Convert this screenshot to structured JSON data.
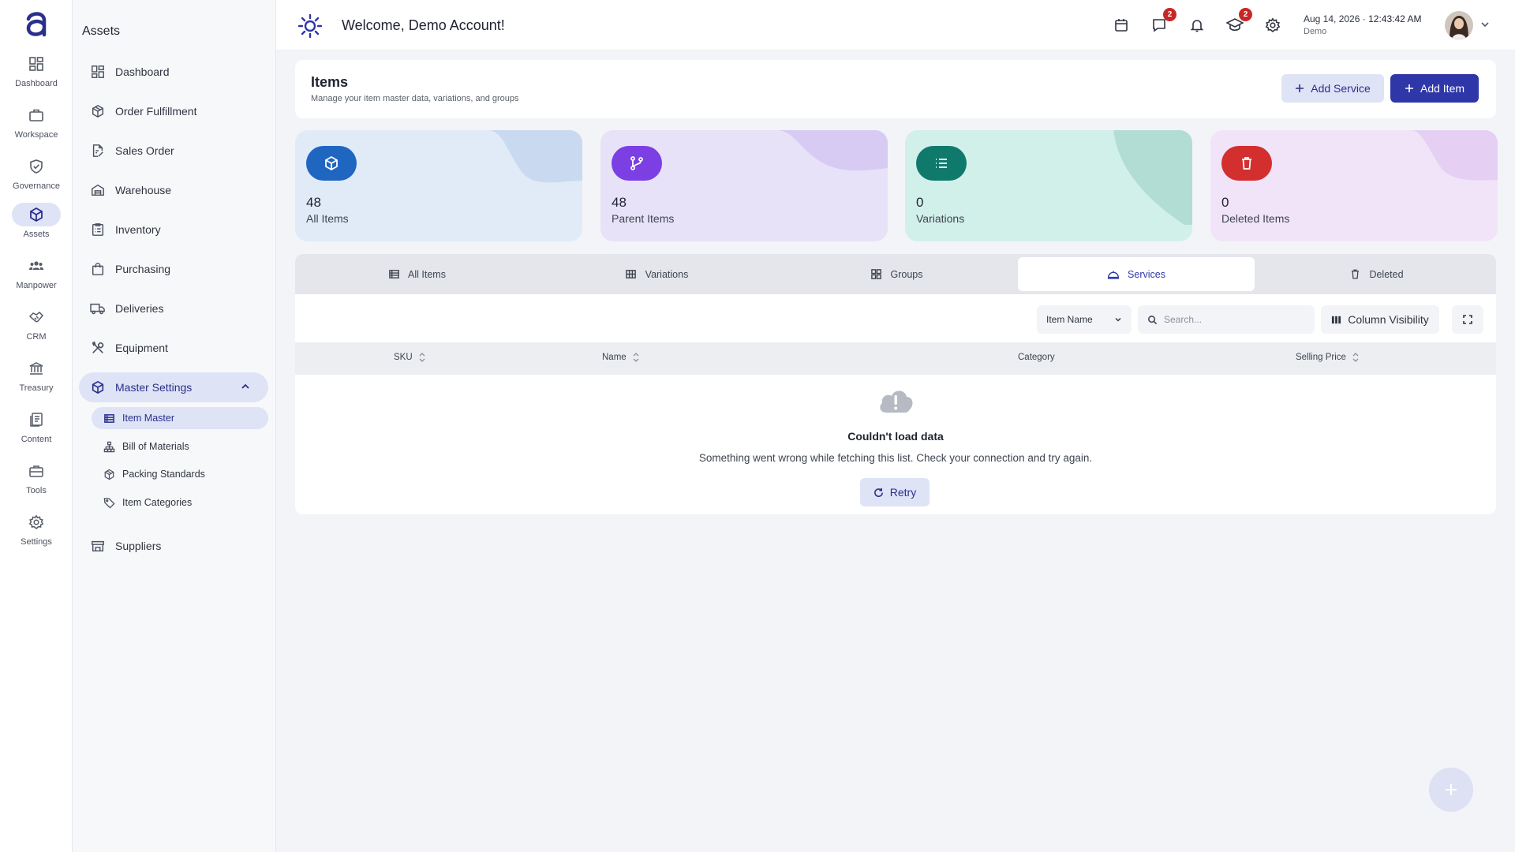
{
  "rail": {
    "items": [
      {
        "label": "Dashboard",
        "icon": "dashboard-grid-icon"
      },
      {
        "label": "Workspace",
        "icon": "briefcase-icon"
      },
      {
        "label": "Governance",
        "icon": "shield-check-icon"
      },
      {
        "label": "Assets",
        "icon": "cube-icon"
      },
      {
        "label": "Manpower",
        "icon": "people-icon"
      },
      {
        "label": "CRM",
        "icon": "handshake-icon"
      },
      {
        "label": "Treasury",
        "icon": "bank-icon"
      },
      {
        "label": "Content",
        "icon": "documents-icon"
      },
      {
        "label": "Tools",
        "icon": "toolbox-icon"
      },
      {
        "label": "Settings",
        "icon": "gear-icon"
      }
    ],
    "active": "Assets"
  },
  "sidebar": {
    "title": "Assets",
    "items": [
      {
        "label": "Dashboard"
      },
      {
        "label": "Order Fulfillment"
      },
      {
        "label": "Sales Order"
      },
      {
        "label": "Warehouse"
      },
      {
        "label": "Inventory"
      },
      {
        "label": "Purchasing"
      },
      {
        "label": "Deliveries"
      },
      {
        "label": "Equipment"
      },
      {
        "label": "Master Settings"
      },
      {
        "label": "Suppliers"
      }
    ],
    "sub_items": [
      {
        "label": "Item Master"
      },
      {
        "label": "Bill of Materials"
      },
      {
        "label": "Packing Standards"
      },
      {
        "label": "Item Categories"
      }
    ]
  },
  "header": {
    "title": "Welcome, Demo Account!",
    "messages_badge": "2",
    "learning_badge": "2",
    "date": "Aug 14, 2026",
    "separator": "·",
    "time": "12:43:42 AM",
    "user": "Demo"
  },
  "page": {
    "title": "Items",
    "subtitle": "Manage your item master data, variations, and groups",
    "add_service": "Add Service",
    "add_item": "Add Item"
  },
  "cards": [
    {
      "value": "48",
      "label": "All Items",
      "color": "#1f66c1",
      "bg": "#e1ebf8"
    },
    {
      "value": "48",
      "label": "Parent Items",
      "color": "#7b3fe4",
      "bg": "#e7e2f7"
    },
    {
      "value": "0",
      "label": "Variations",
      "color": "#0f7a6c",
      "bg": "#d2f0ea"
    },
    {
      "value": "0",
      "label": "Deleted Items",
      "color": "#d32f2f",
      "bg": "#f1e4f8"
    }
  ],
  "tabs": [
    {
      "label": "All Items"
    },
    {
      "label": "Variations"
    },
    {
      "label": "Groups"
    },
    {
      "label": "Services"
    },
    {
      "label": "Deleted"
    }
  ],
  "active_tab": "Services",
  "toolbar": {
    "filter_field": "Item Name",
    "search_placeholder": "Search...",
    "column_visibility": "Column Visibility"
  },
  "table": {
    "columns": [
      "SKU",
      "Name",
      "Category",
      "Selling Price"
    ]
  },
  "error": {
    "title": "Couldn't load data",
    "message": "Something went wrong while fetching this list. Check your connection and try again.",
    "retry": "Retry"
  }
}
